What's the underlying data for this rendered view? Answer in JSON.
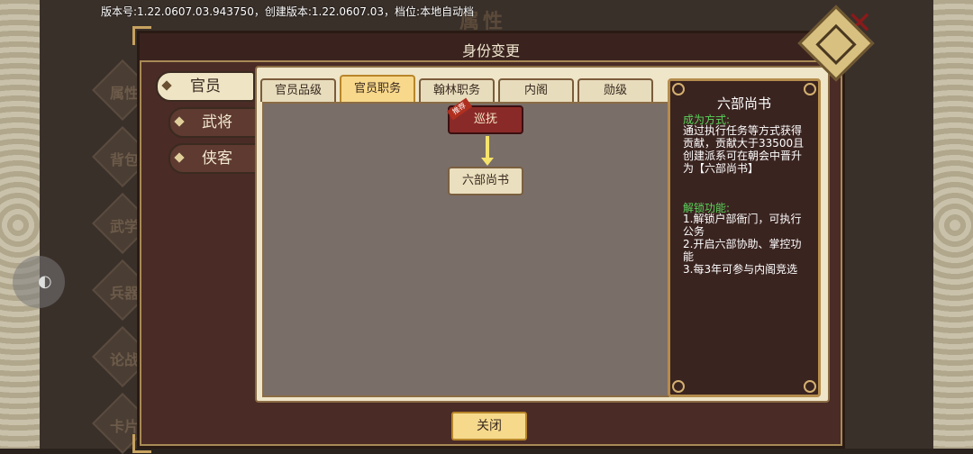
{
  "version_bar": "版本号:1.22.0607.03.943750，创建版本:1.22.0607.03，档位:本地自动档",
  "background": {
    "title": "属性",
    "side_labels": [
      "属性",
      "背包",
      "武学",
      "兵器",
      "论战",
      "卡片"
    ]
  },
  "dialog": {
    "title": "身份变更",
    "nav_tabs": [
      {
        "label": "官员",
        "active": true
      },
      {
        "label": "武将",
        "active": false
      },
      {
        "label": "侠客",
        "active": false
      }
    ],
    "sub_tabs": [
      {
        "label": "官员品级",
        "active": false
      },
      {
        "label": "官员职务",
        "active": true
      },
      {
        "label": "翰林职务",
        "active": false
      },
      {
        "label": "内阁",
        "active": false
      },
      {
        "label": "勋级",
        "active": false
      }
    ],
    "tree": {
      "top_node": {
        "label": "巡抚",
        "tag": "推荐"
      },
      "bottom_node": {
        "label": "六部尚书"
      }
    },
    "info": {
      "title": "六部尚书",
      "method_label": "成为方式:",
      "method_text": "通过执行任务等方式获得贡献，贡献大于33500且创建派系可在朝会中晋升为【六部尚书】",
      "unlock_label": "解锁功能:",
      "unlock_items": [
        "1.解锁户部衙门，可执行公务",
        "2.开启六部协助、掌控功能",
        "3.每3年可参与内阁竞选"
      ]
    },
    "close_label": "关闭"
  },
  "colors": {
    "accent_gold": "#b48c4c",
    "active_tab": "#f8d88a",
    "section_green": "#5bd35b",
    "node_red": "#8a2a28"
  }
}
